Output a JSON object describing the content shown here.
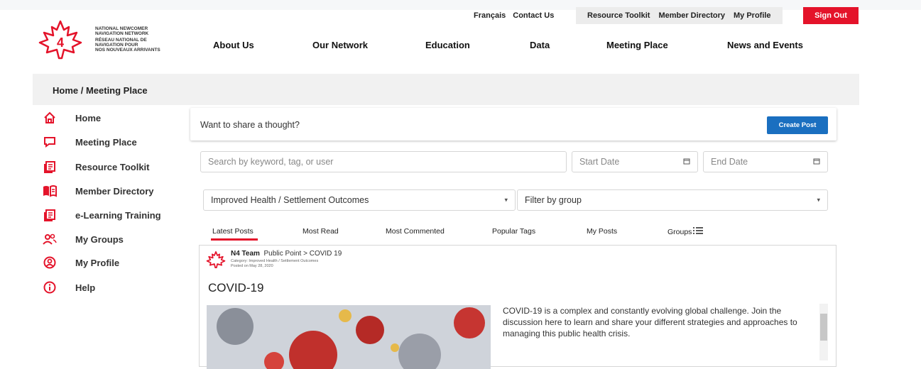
{
  "util_nav": {
    "francais": "Français",
    "contact": "Contact Us",
    "resource_toolkit": "Resource Toolkit",
    "member_directory": "Member Directory",
    "my_profile": "My Profile",
    "sign_out": "Sign Out"
  },
  "logo": {
    "line1": "NATIONAL NEWCOMER",
    "line2": "NAVIGATION NETWORK",
    "line3": "RÉSEAU NATIONAL DE",
    "line4": "NAVIGATION POUR",
    "line5": "NOS NOUVEAUX ARRIVANTS",
    "mark": "4"
  },
  "main_nav": [
    "About Us",
    "Our Network",
    "Education",
    "Data",
    "Meeting Place",
    "News and Events"
  ],
  "breadcrumb": "Home /  Meeting Place",
  "sidebar": [
    {
      "label": "Home",
      "icon": "home-icon"
    },
    {
      "label": "Meeting Place",
      "icon": "chat-icon"
    },
    {
      "label": "Resource Toolkit",
      "icon": "document-icon"
    },
    {
      "label": "Member Directory",
      "icon": "book-icon"
    },
    {
      "label": "e-Learning Training",
      "icon": "document-icon"
    },
    {
      "label": "My Groups",
      "icon": "group-icon"
    },
    {
      "label": "My Profile",
      "icon": "profile-icon"
    },
    {
      "label": "Help",
      "icon": "info-icon"
    }
  ],
  "composer": {
    "prompt": "Want to share a thought?",
    "create_label": "Create Post"
  },
  "filters": {
    "search_placeholder": "Search by keyword, tag, or user",
    "start_date": "Start Date",
    "end_date": "End Date",
    "category": "Improved Health / Settlement Outcomes",
    "group": "Filter by group"
  },
  "tabs": [
    "Latest Posts",
    "Most Read",
    "Most Commented",
    "Popular Tags",
    "My Posts",
    "Groups"
  ],
  "post": {
    "author": "N4 Team",
    "location": "Public Point > COVID 19",
    "category": "Category: Improved Health / Settlement Outcomes",
    "posted": "Posted on May 28, 2020",
    "title": "COVID-19",
    "body": "COVID-19 is a complex and constantly evolving global challenge. Join the discussion here to learn and share your different strategies and approaches to managing this public health crisis."
  },
  "colors": {
    "accent": "#e4132a",
    "primary_button": "#1a6fc0"
  }
}
